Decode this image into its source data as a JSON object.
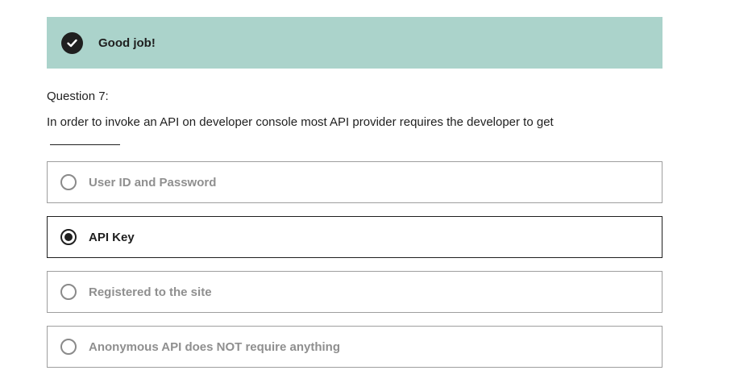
{
  "feedback": {
    "icon": "check-circle-icon",
    "message": "Good job!",
    "color": "#abd3cb"
  },
  "question": {
    "number_label": "Question 7:",
    "text": "In order to invoke an API on developer console most API provider requires the developer to get"
  },
  "options": [
    {
      "label": "User ID and Password",
      "selected": false
    },
    {
      "label": "API Key",
      "selected": true
    },
    {
      "label": "Registered to the site",
      "selected": false
    },
    {
      "label": "Anonymous API does NOT require anything",
      "selected": false
    }
  ]
}
